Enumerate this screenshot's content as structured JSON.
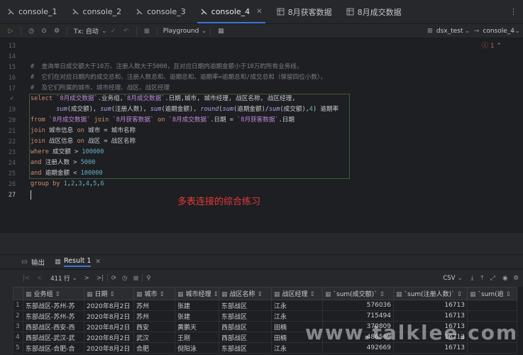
{
  "tabs": [
    {
      "label": "console_1",
      "active": false
    },
    {
      "label": "console_2",
      "active": false
    },
    {
      "label": "console_3",
      "active": false
    },
    {
      "label": "console_4",
      "active": true
    },
    {
      "label": "8月获客数据",
      "active": false
    },
    {
      "label": "8月成交数据",
      "active": false
    }
  ],
  "toolbar": {
    "tx": "Tx: 自动",
    "playground": "Playground",
    "datasource": "dsx_test",
    "console": "console_4"
  },
  "editor": {
    "errors": "1",
    "lines": [
      {
        "n": "13",
        "code": ""
      },
      {
        "n": "14",
        "code": ""
      },
      {
        "n": "15",
        "code": "#  查询单日成交额大于10万、注册人数大于5000，且对应日期内逾期金额小于10万的所有业务线，"
      },
      {
        "n": "16",
        "code": "#  它们在对应日期内的成交总和、注册人数总和、逾期总和、逾期率=逾期总和/成交总和（保留四位小数），"
      },
      {
        "n": "17",
        "code": "#  及它们所属的城市、城市经理、战区、战区经理"
      },
      {
        "n": "18",
        "code": "select `8月成交数据`.业务组,`8月成交数据`.日期,城市, 城市经理, 战区名称, 战区经理,"
      },
      {
        "n": "19",
        "code": "       sum(成交额), sum(注册人数), sum(逾期金额), round(sum(逾期金额)/sum(成交额),4) 逾期率"
      },
      {
        "n": "20",
        "code": "from `8月成交数据` join `8月获客数据` on `8月成交数据`.日期 = `8月获客数据`.日期"
      },
      {
        "n": "21",
        "code": "join 城市信息 on 城市 = 城市名称"
      },
      {
        "n": "22",
        "code": "join 战区信息 on 战区 = 战区名称"
      },
      {
        "n": "23",
        "code": "where 成交额 > 100000"
      },
      {
        "n": "24",
        "code": "and 注册人数 > 5000"
      },
      {
        "n": "25",
        "code": "and 逾期金额 < 100000"
      },
      {
        "n": "26",
        "code": "group by 1,2,3,4,5,6"
      },
      {
        "n": "27",
        "code": ""
      }
    ],
    "caption": "多表连接的综合练习"
  },
  "panel": {
    "output_tab": "输出",
    "result_tab": "Result 1"
  },
  "results": {
    "row_count": "411 行",
    "format": "CSV",
    "columns": [
      "业务组",
      "日期",
      "城市",
      "城市经理",
      "战区名称",
      "战区经理",
      "`sum(成交额)`",
      "`sum(注册人数)`",
      "`sum(逾"
    ],
    "rows": [
      [
        "1",
        "东部战区-苏州-苏",
        "2020年8月2日",
        "苏州",
        "张建",
        "东部战区",
        "江永",
        "576036",
        "16713"
      ],
      [
        "2",
        "东部战区-苏州-苏",
        "2020年8月2日",
        "苏州",
        "张建",
        "东部战区",
        "江永",
        "715494",
        "16713"
      ],
      [
        "3",
        "西部战区-西安-西",
        "2020年8月2日",
        "西安",
        "黄鹏天",
        "西部战区",
        "田楠",
        "370809",
        "16713"
      ],
      [
        "4",
        "西部战区-武汉-武",
        "2020年8月2日",
        "武汉",
        "王刚",
        "西部战区",
        "田楠",
        "486569",
        "16713"
      ],
      [
        "5",
        "东部战区-合肥-合",
        "2020年8月2日",
        "合肥",
        "倪阳泳",
        "东部战区",
        "江永",
        "492669",
        "16713"
      ]
    ]
  },
  "watermark": "www.talklee.com"
}
